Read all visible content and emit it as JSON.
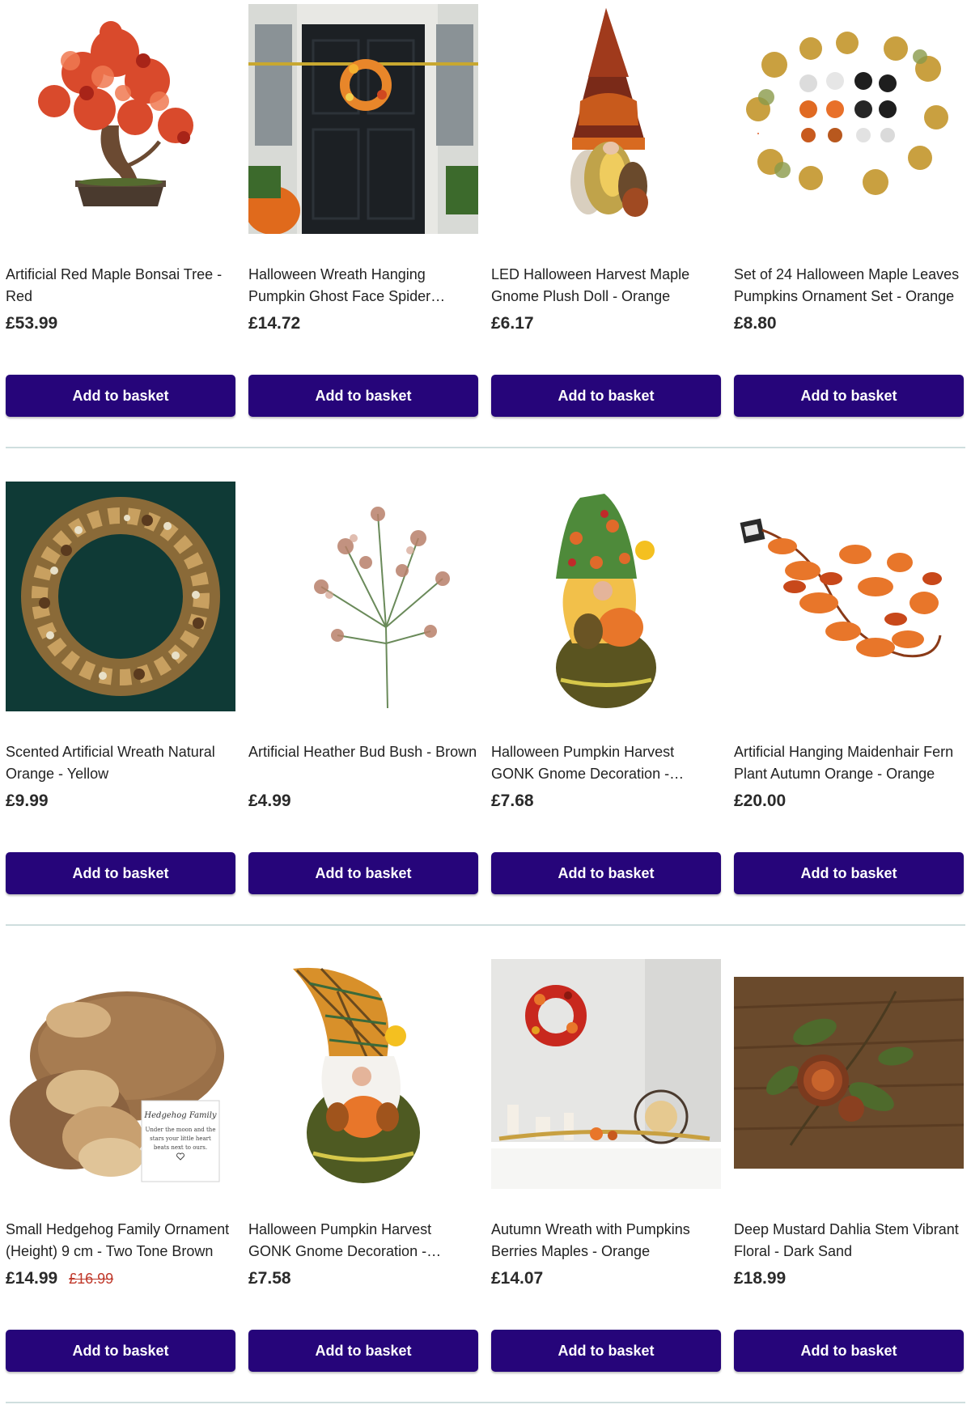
{
  "button_label": "Add to basket",
  "colors": {
    "button_bg": "#26057a",
    "button_text": "#ffffff",
    "was_price": "#c0392b",
    "divider": "#cfdede"
  },
  "products": [
    {
      "title": "Artificial Red Maple Bonsai Tree - Red",
      "price": "£53.99",
      "image_name": "bonsai-tree-image"
    },
    {
      "title": "Halloween Wreath Hanging Pumpkin Ghost Face Spider Maple...",
      "price": "£14.72",
      "image_name": "door-wreath-image"
    },
    {
      "title": "LED Halloween Harvest Maple Gnome Plush Doll - Orange",
      "price": "£6.17",
      "image_name": "led-gnome-image"
    },
    {
      "title": "Set of 24 Halloween Maple Leaves Pumpkins Ornament Set - Orange",
      "price": "£8.80",
      "image_name": "leaves-pumpkins-image"
    },
    {
      "title": "Scented Artificial Wreath Natural Orange - Yellow",
      "price": "£9.99",
      "image_name": "pinecone-wreath-image"
    },
    {
      "title": "Artificial Heather Bud Bush - Brown",
      "price": "£4.99",
      "image_name": "heather-bush-image"
    },
    {
      "title": "Halloween Pumpkin Harvest GONK Gnome Decoration - Multicolour",
      "price": "£7.68",
      "image_name": "gonk-gnome-image"
    },
    {
      "title": "Artificial Hanging Maidenhair Fern Plant Autumn Orange - Orange",
      "price": "£20.00",
      "image_name": "fern-garland-image"
    },
    {
      "title": "Small Hedgehog Family Ornament (Height) 9 cm - Two Tone Brown",
      "price": "£14.99",
      "was_price": "£16.99",
      "image_name": "hedgehog-ornament-image",
      "plaque": {
        "heading": "Hedgehog Family",
        "line1": "Under the moon and the",
        "line2": "stars your little heart",
        "line3": "beats next to ours."
      }
    },
    {
      "title": "Halloween Pumpkin Harvest GONK Gnome Decoration - Multicolour",
      "price": "£7.58",
      "image_name": "plaid-gnome-image"
    },
    {
      "title": "Autumn Wreath with Pumpkins Berries Maples - Orange",
      "price": "£14.07",
      "image_name": "mantel-wreath-image"
    },
    {
      "title": "Deep Mustard Dahlia Stem Vibrant Floral - Dark Sand",
      "price": "£18.99",
      "image_name": "dahlia-stem-image"
    }
  ]
}
